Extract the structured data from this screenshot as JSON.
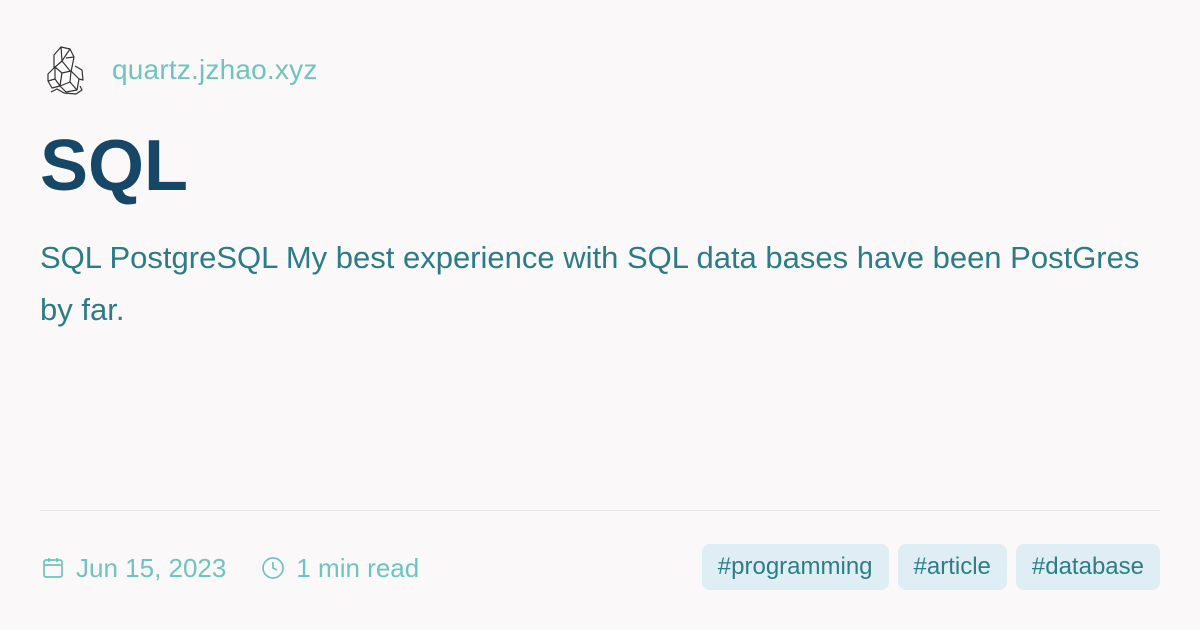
{
  "site": {
    "name": "quartz.jzhao.xyz",
    "logo_icon": "crystal-logo-icon"
  },
  "page": {
    "title": "SQL",
    "description": "SQL PostgreSQL My best experience with SQL data bases have been PostGres by far."
  },
  "meta": {
    "date_icon": "calendar-icon",
    "date": "Jun 15, 2023",
    "reading_time_icon": "clock-icon",
    "reading_time": "1 min read"
  },
  "tags": [
    {
      "label": "#programming"
    },
    {
      "label": "#article"
    },
    {
      "label": "#database"
    }
  ],
  "colors": {
    "background": "#faf8f8",
    "title": "#174766",
    "description": "#2b7c86",
    "accent": "#6fc4bd",
    "tag_background": "#dfeef4",
    "tag_text": "#2d7d88"
  }
}
